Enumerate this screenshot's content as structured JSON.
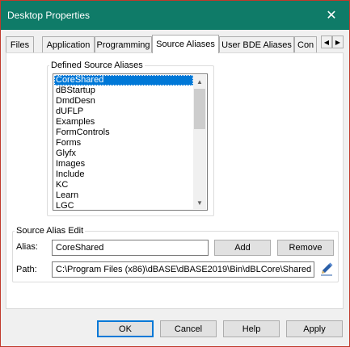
{
  "window": {
    "title": "Desktop Properties"
  },
  "tabs": [
    {
      "label": "Files"
    },
    {
      "label": "Application"
    },
    {
      "label": "Programming"
    },
    {
      "label": "Source Aliases"
    },
    {
      "label": "User BDE Aliases"
    },
    {
      "label": "Con"
    }
  ],
  "defined_aliases": {
    "legend": "Defined Source Aliases",
    "items": [
      "CoreShared",
      "dBStartup",
      "DmdDesn",
      "dUFLP",
      "Examples",
      "FormControls",
      "Forms",
      "Glyfx",
      "Images",
      "Include",
      "KC",
      "Learn",
      "LGC"
    ],
    "selected": "CoreShared"
  },
  "alias_edit": {
    "legend": "Source Alias Edit",
    "alias_label": "Alias:",
    "alias_value": "CoreShared",
    "add_label": "Add",
    "remove_label": "Remove",
    "path_label": "Path:",
    "path_value": "C:\\Program Files (x86)\\dBASE\\dBASE2019\\Bin\\dBLCore\\Shared"
  },
  "footer": {
    "ok": "OK",
    "cancel": "Cancel",
    "help": "Help",
    "apply": "Apply"
  },
  "colors": {
    "titlebar": "#0f7b68",
    "selection": "#0078d7"
  }
}
